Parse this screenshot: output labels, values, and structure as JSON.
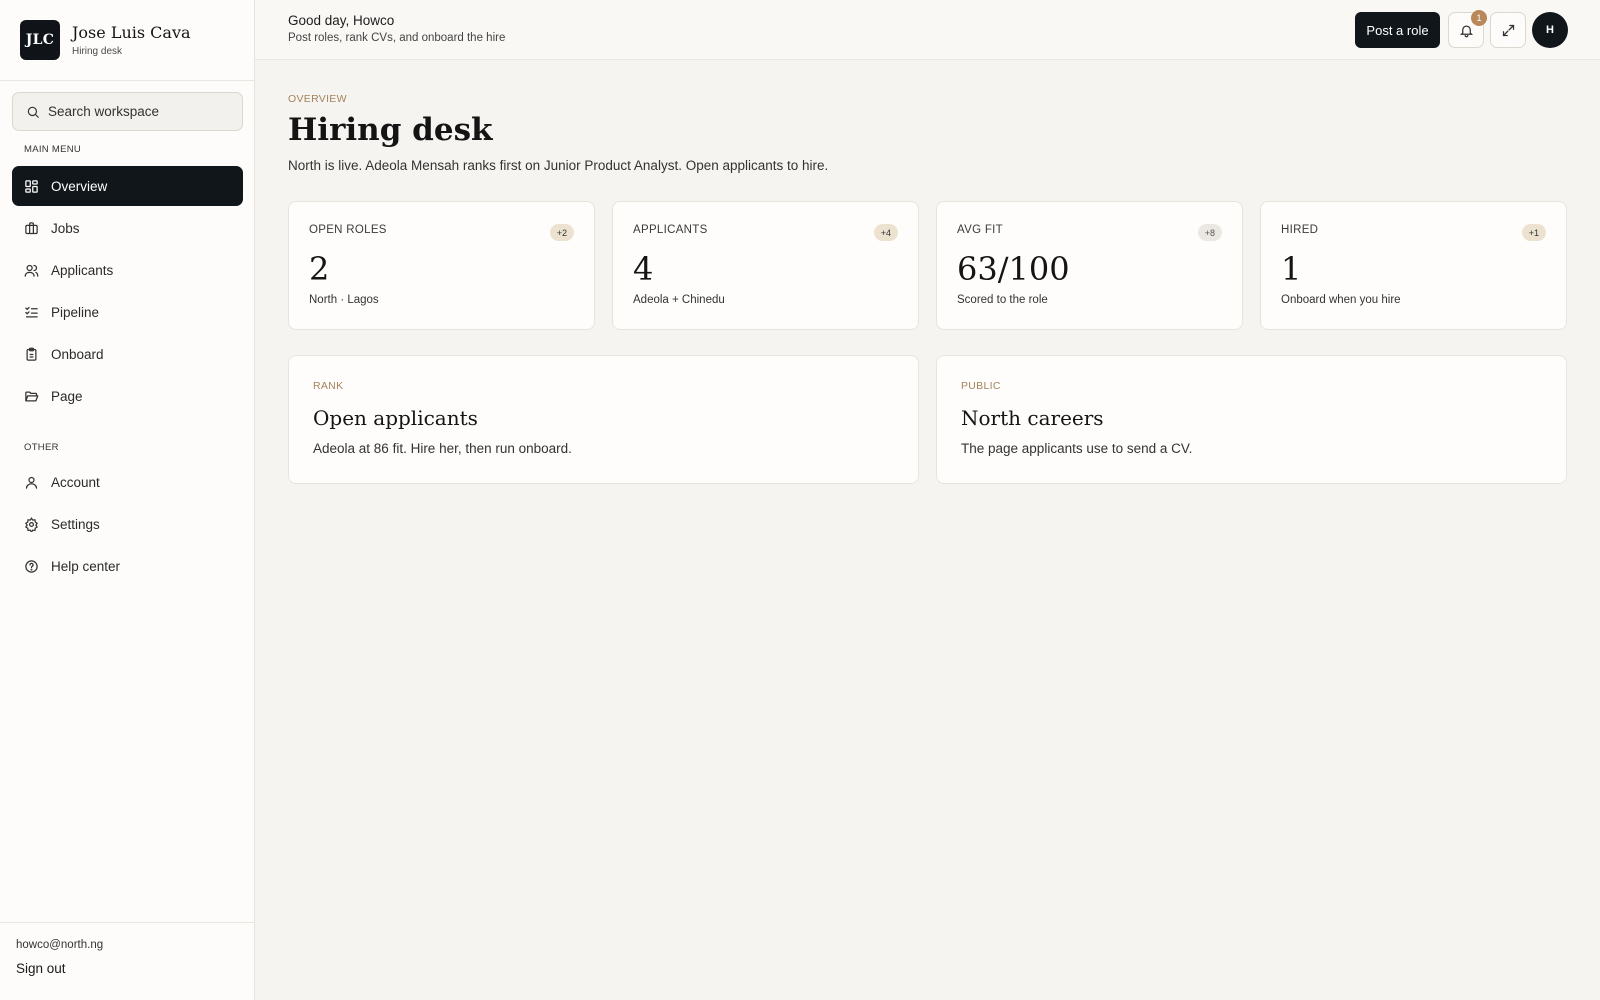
{
  "brand": {
    "initials": "JLC",
    "name": "Jose Luis Cava",
    "subtitle": "Hiring desk"
  },
  "search": {
    "placeholder": "Search workspace"
  },
  "nav": {
    "main_label": "MAIN MENU",
    "main_items": [
      {
        "label": "Overview",
        "icon": "grid-icon",
        "active": true
      },
      {
        "label": "Jobs",
        "icon": "briefcase-icon"
      },
      {
        "label": "Applicants",
        "icon": "users-icon"
      },
      {
        "label": "Pipeline",
        "icon": "list-checks-icon"
      },
      {
        "label": "Onboard",
        "icon": "clipboard-icon"
      },
      {
        "label": "Page",
        "icon": "folder-open-icon"
      }
    ],
    "other_label": "OTHER",
    "other_items": [
      {
        "label": "Account",
        "icon": "user-icon"
      },
      {
        "label": "Settings",
        "icon": "gear-icon"
      },
      {
        "label": "Help center",
        "icon": "help-circle-icon"
      }
    ]
  },
  "footer": {
    "email": "howco@north.ng",
    "sign_out": "Sign out"
  },
  "header": {
    "greeting": "Good day, Howco",
    "subtitle": "Post roles, rank CVs, and onboard the hire",
    "post_button": "Post a role",
    "notification_count": "1",
    "avatar_initial": "H"
  },
  "overview": {
    "eyebrow": "OVERVIEW",
    "title": "Hiring desk",
    "description": "North is live. Adeola Mensah ranks first on Junior Product Analyst. Open applicants to hire."
  },
  "stats": [
    {
      "label": "OPEN ROLES",
      "delta": "+2",
      "value": "2",
      "sub": "North · Lagos"
    },
    {
      "label": "APPLICANTS",
      "delta": "+4",
      "value": "4",
      "sub": "Adeola + Chinedu"
    },
    {
      "label": "AVG FIT",
      "delta": "+8",
      "value": "63/100",
      "sub": "Scored to the role"
    },
    {
      "label": "HIRED",
      "delta": "+1",
      "value": "1",
      "sub": "Onboard when you hire"
    }
  ],
  "features": [
    {
      "eyebrow": "RANK",
      "title": "Open applicants",
      "description": "Adeola at 86 fit. Hire her, then run onboard."
    },
    {
      "eyebrow": "PUBLIC",
      "title": "North careers",
      "description": "The page applicants use to send a CV."
    }
  ],
  "colors": {
    "accent": "#a4845c",
    "dark": "#11161a",
    "badge": "#b8875a"
  }
}
